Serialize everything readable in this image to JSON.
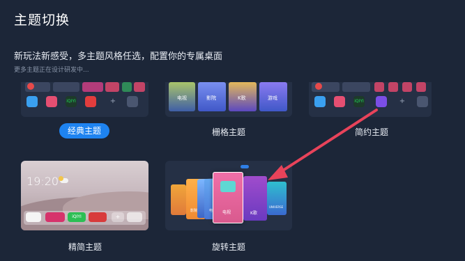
{
  "page": {
    "title": "主题切换",
    "subtitle": "新玩法新感受，多主题风格任选，配置你的专属桌面",
    "hint": "更多主题正在设计研发中..."
  },
  "themes": [
    {
      "label": "经典主题",
      "selected": true
    },
    {
      "label": "栅格主题",
      "selected": false
    },
    {
      "label": "简约主题",
      "selected": false
    },
    {
      "label": "精简主题",
      "selected": false
    },
    {
      "label": "旋转主题",
      "selected": false
    }
  ],
  "classic": {
    "tiles": [
      "iQIYI"
    ]
  },
  "grid": {
    "tiles": [
      "电视",
      "影院",
      "K歌",
      "游戏"
    ]
  },
  "simple": {
    "tiles": [
      "iQIYI"
    ]
  },
  "compact": {
    "clock": "19:20",
    "tiles": [
      "iQIYI",
      "iQIYI"
    ]
  },
  "rotate": {
    "tiles": [
      "影院",
      "电视",
      "K歌",
      "UNIVERSE"
    ]
  },
  "colors": {
    "accent": "#1e83f0",
    "arrow": "#e8435a",
    "background": "#1c2638"
  }
}
